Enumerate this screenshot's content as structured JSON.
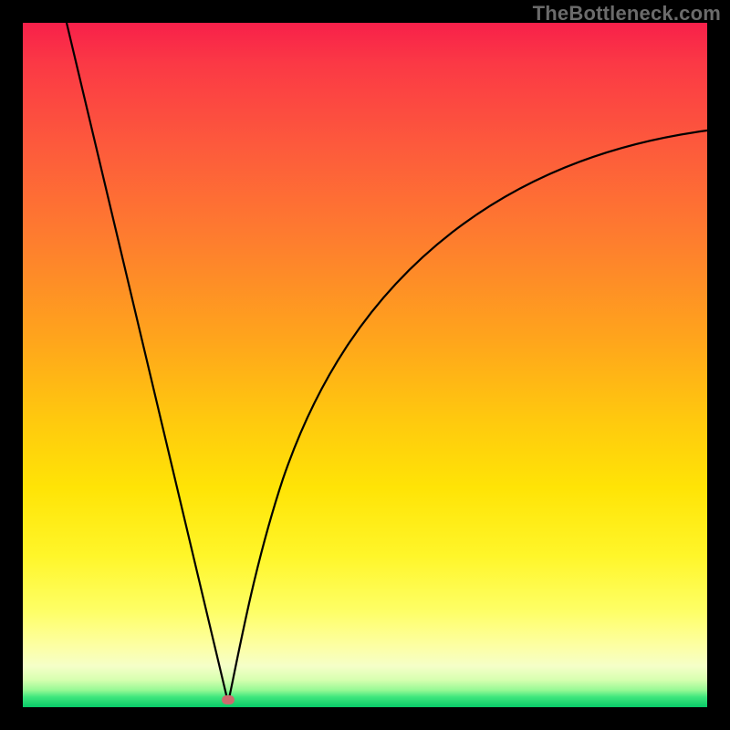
{
  "watermark": "TheBottleneck.com",
  "colors": {
    "background": "#000000",
    "curve": "#000000",
    "marker": "#cd6b6e",
    "gradient_top": "#f8204a",
    "gradient_bottom": "#08c968"
  },
  "chart_data": {
    "type": "line",
    "title": "",
    "xlabel": "",
    "ylabel": "",
    "xlim": [
      0,
      100
    ],
    "ylim": [
      0,
      100
    ],
    "grid": false,
    "legend": false,
    "background": "vertical rainbow gradient (red top → green bottom), black frame border",
    "annotations": [
      {
        "text": "TheBottleneck.com",
        "position": "top-right"
      }
    ],
    "marker_point": {
      "x": 30,
      "y": 0,
      "note": "small rounded oval marker at curve minimum"
    },
    "series": [
      {
        "name": "left-branch",
        "note": "near-linear descent from top-left region into the vertex",
        "x": [
          6,
          10,
          14,
          18,
          22,
          26,
          29,
          30
        ],
        "y": [
          100,
          83,
          67,
          50,
          33,
          17,
          3,
          0
        ]
      },
      {
        "name": "right-branch",
        "note": "steep rise out of the vertex, decelerating toward the right edge (does not reach the top)",
        "x": [
          30,
          31,
          33,
          36,
          40,
          46,
          54,
          64,
          76,
          88,
          100
        ],
        "y": [
          0,
          5,
          15,
          28,
          41,
          53,
          63,
          71,
          77,
          81,
          84
        ]
      }
    ]
  }
}
